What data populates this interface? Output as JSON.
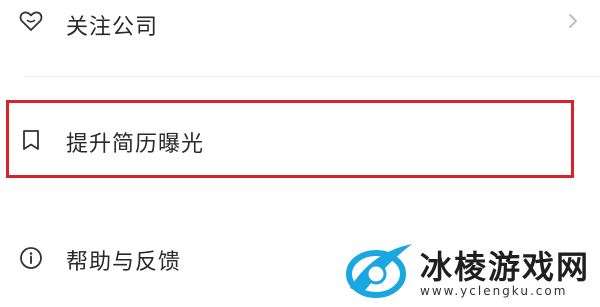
{
  "menu": {
    "items": [
      {
        "label": "关注公司",
        "icon": "heart-icon",
        "has_chevron": true
      },
      {
        "label": "提升简历曝光",
        "icon": "bookmark-icon",
        "highlighted": true
      },
      {
        "label": "帮助与反馈",
        "icon": "info-icon"
      }
    ]
  },
  "annotation": {
    "highlight_color": "#d8222c"
  },
  "watermark": {
    "title": "冰棱游戏网",
    "url": "www.yclengku.com",
    "logo_color": "#1aa6e0"
  }
}
